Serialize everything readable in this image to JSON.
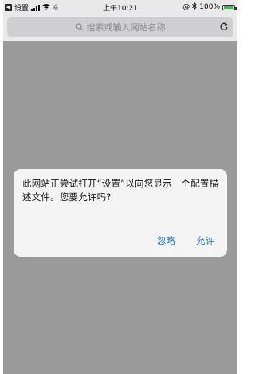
{
  "status_bar": {
    "carrier_label": "设置",
    "time": "上午10:21",
    "battery_text": "100%",
    "battery_level_pct": 100
  },
  "url_bar": {
    "placeholder": "搜索或输入网站名称"
  },
  "alert": {
    "message": "此网站正尝试打开“设置”以向您显示一个配置描述文件。您要允许吗?",
    "ignore_label": "忽略",
    "allow_label": "允许"
  },
  "colors": {
    "accent": "#2a7ae2",
    "overlay": "#9a9a9a",
    "battery": "#3cc13c"
  }
}
